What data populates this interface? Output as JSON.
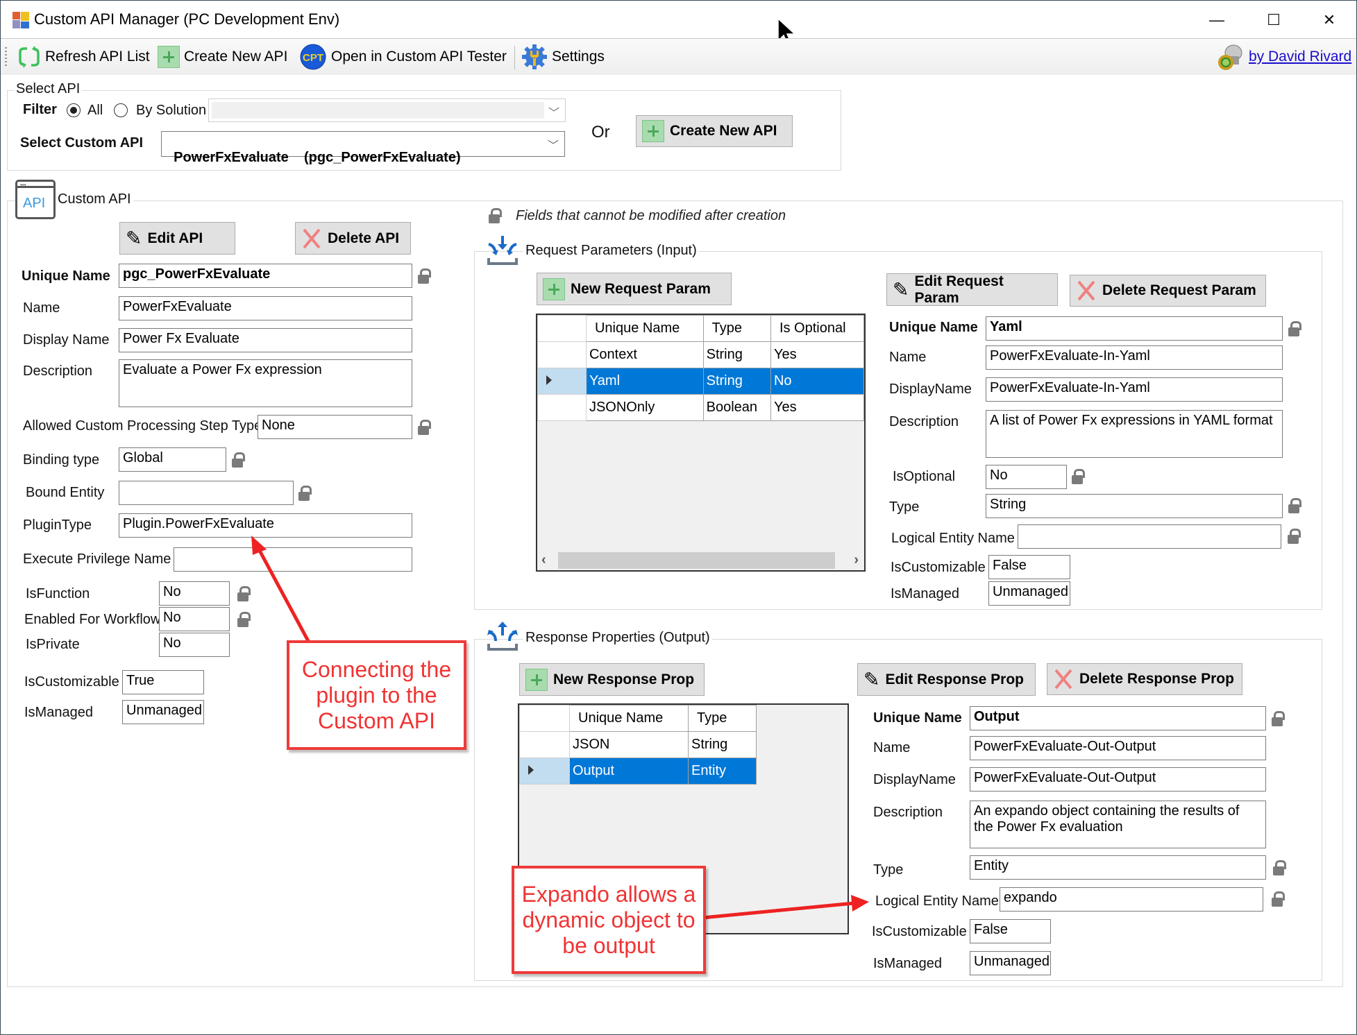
{
  "window": {
    "title": "Custom API Manager (PC Development Env)",
    "controls": {
      "minimize": "—",
      "maximize": "☐",
      "close": "✕"
    }
  },
  "toolbar": {
    "refresh_label": "Refresh API List",
    "create_label": "Create New API",
    "tester_label": "Open in Custom API Tester",
    "settings_label": "Settings",
    "author_link": "by David Rivard"
  },
  "select_api": {
    "group_label": "Select API",
    "filter_label": "Filter",
    "filter_options": [
      "All",
      "By Solution"
    ],
    "filter_selected": "All",
    "solution_value": "",
    "select_label": "Select Custom API",
    "selected_api": "PowerFxEvaluate    (pgc_PowerFxEvaluate)",
    "or_label": "Or",
    "create_button": "Create New API"
  },
  "custom_api": {
    "group_label": "Custom API",
    "icon_text": "API",
    "edit_button": "Edit API",
    "delete_button": "Delete API",
    "fields": {
      "unique_name": {
        "label": "Unique Name",
        "value": "pgc_PowerFxEvaluate"
      },
      "name": {
        "label": "Name",
        "value": "PowerFxEvaluate"
      },
      "display_name": {
        "label": "Display Name",
        "value": "Power Fx Evaluate"
      },
      "description": {
        "label": "Description",
        "value": "Evaluate a Power Fx expression"
      },
      "allowed_step_type": {
        "label": "Allowed Custom Processing Step Type",
        "value": "None"
      },
      "binding_type": {
        "label": "Binding type",
        "value": "Global"
      },
      "bound_entity": {
        "label": "Bound Entity",
        "value": ""
      },
      "plugin_type": {
        "label": "PluginType",
        "value": "Plugin.PowerFxEvaluate"
      },
      "execute_privilege": {
        "label": "Execute Privilege Name",
        "value": ""
      },
      "is_function": {
        "label": "IsFunction",
        "value": "No"
      },
      "enabled_for_workflow": {
        "label": "Enabled For Workflow",
        "value": "No"
      },
      "is_private": {
        "label": "IsPrivate",
        "value": "No"
      },
      "is_customizable": {
        "label": "IsCustomizable",
        "value": "True"
      },
      "is_managed": {
        "label": "IsManaged",
        "value": "Unmanaged"
      }
    }
  },
  "legend": {
    "locked_note": "Fields that cannot be modified after creation"
  },
  "request": {
    "group_label": "Request Parameters (Input)",
    "new_button": "New Request Param",
    "edit_button": "Edit Request Param",
    "delete_button": "Delete Request Param",
    "columns": [
      "Unique Name",
      "Type",
      "Is Optional"
    ],
    "rows": [
      {
        "unique_name": "Context",
        "type": "String",
        "is_optional": "Yes",
        "selected": false
      },
      {
        "unique_name": "Yaml",
        "type": "String",
        "is_optional": "No",
        "selected": true
      },
      {
        "unique_name": "JSONOnly",
        "type": "Boolean",
        "is_optional": "Yes",
        "selected": false
      }
    ],
    "fields": {
      "unique_name": {
        "label": "Unique Name",
        "value": "Yaml"
      },
      "name": {
        "label": "Name",
        "value": "PowerFxEvaluate-In-Yaml"
      },
      "display_name": {
        "label": "DisplayName",
        "value": "PowerFxEvaluate-In-Yaml"
      },
      "description": {
        "label": "Description",
        "value": "A list of Power Fx expressions in YAML format"
      },
      "is_optional": {
        "label": "IsOptional",
        "value": "No"
      },
      "type": {
        "label": "Type",
        "value": "String"
      },
      "logical_entity_name": {
        "label": "Logical Entity Name",
        "value": ""
      },
      "is_customizable": {
        "label": "IsCustomizable",
        "value": "False"
      },
      "is_managed": {
        "label": "IsManaged",
        "value": "Unmanaged"
      }
    }
  },
  "response": {
    "group_label": "Response Properties (Output)",
    "new_button": "New Response Prop",
    "edit_button": "Edit Response Prop",
    "delete_button": "Delete Response Prop",
    "columns": [
      "Unique Name",
      "Type"
    ],
    "rows": [
      {
        "unique_name": "JSON",
        "type": "String",
        "selected": false
      },
      {
        "unique_name": "Output",
        "type": "Entity",
        "selected": true
      }
    ],
    "fields": {
      "unique_name": {
        "label": "Unique Name",
        "value": "Output"
      },
      "name": {
        "label": "Name",
        "value": "PowerFxEvaluate-Out-Output"
      },
      "display_name": {
        "label": "DisplayName",
        "value": "PowerFxEvaluate-Out-Output"
      },
      "description": {
        "label": "Description",
        "value": "An expando object containing the results of the Power Fx evaluation"
      },
      "type": {
        "label": "Type",
        "value": "Entity"
      },
      "logical_entity_name": {
        "label": "Logical Entity Name",
        "value": "expando"
      },
      "is_customizable": {
        "label": "IsCustomizable",
        "value": "False"
      },
      "is_managed": {
        "label": "IsManaged",
        "value": "Unmanaged"
      }
    }
  },
  "annotations": {
    "plugin_callout": "Connecting the plugin to the Custom API",
    "expando_callout": "Expando allows a dynamic object to be output",
    "color": "#f03333"
  },
  "colors": {
    "selection": "#0078d7",
    "row_header_selected": "#c2dcf0",
    "button_face": "#e1e1e1",
    "link": "#1a0dcc"
  }
}
